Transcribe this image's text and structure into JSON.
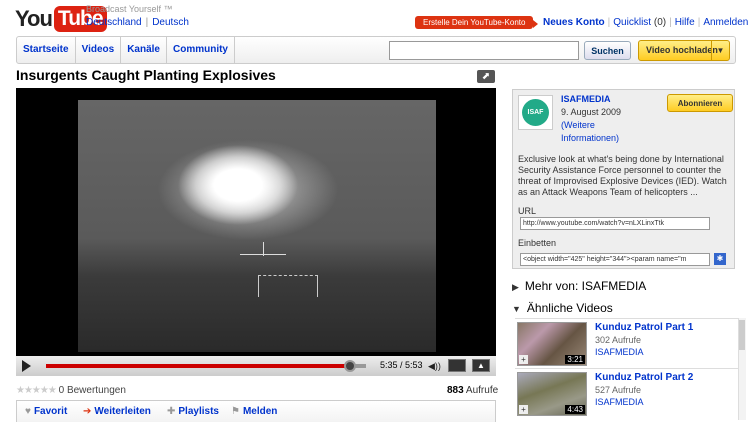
{
  "header": {
    "logo": {
      "you": "You",
      "tube": "Tube"
    },
    "tagline": "Broadcast Yourself ™",
    "region": {
      "country": "Deutschland",
      "language": "Deutsch"
    },
    "cta": "Erstelle Dein YouTube-Konto",
    "toplinks": {
      "new_account": "Neues Konto",
      "quicklist": "Quicklist",
      "quicklist_count": "(0)",
      "help": "Hilfe",
      "login": "Anmelden"
    }
  },
  "nav": {
    "tabs": [
      "Startseite",
      "Videos",
      "Kanäle",
      "Community"
    ],
    "search_placeholder": "",
    "search_button": "Suchen",
    "upload_button": "Video hochladen"
  },
  "video": {
    "title": "Insurgents Caught Planting Explosives",
    "time": "5:35 / 5:53",
    "progress_fraction": 0.95,
    "ratings": "0 Bewertungen",
    "views_count": "883",
    "views_label": "Aufrufe",
    "actions": {
      "favorite": "Favorit",
      "share": "Weiterleiten",
      "playlists": "Playlists",
      "report": "Melden"
    }
  },
  "channel": {
    "avatar_text": "ISAF",
    "name": "ISAFMEDIA",
    "date": "9. August 2009",
    "more_info": "(Weitere Informationen)",
    "subscribe": "Abonnieren",
    "description": "Exclusive look at what's being done by International Security Assistance Force personnel to counter the threat of Improvised Explosive Devices (IED). Watch as an Attack Weapons Team of helicopters ...",
    "url_label": "URL",
    "url_value": "http://www.youtube.com/watch?v=nLXLinxTtk",
    "embed_label": "Einbetten",
    "embed_value": "<object width=\"425\" height=\"344\"><param name=\"m"
  },
  "sections": {
    "more_from": "Mehr von: ISAFMEDIA",
    "similar": "Ähnliche Videos"
  },
  "related": [
    {
      "title": "Kunduz Patrol Part 1",
      "views": "302 Aufrufe",
      "channel": "ISAFMEDIA",
      "duration": "3:21"
    },
    {
      "title": "Kunduz Patrol Part 2",
      "views": "527 Aufrufe",
      "channel": "ISAFMEDIA",
      "duration": "4:43"
    }
  ]
}
